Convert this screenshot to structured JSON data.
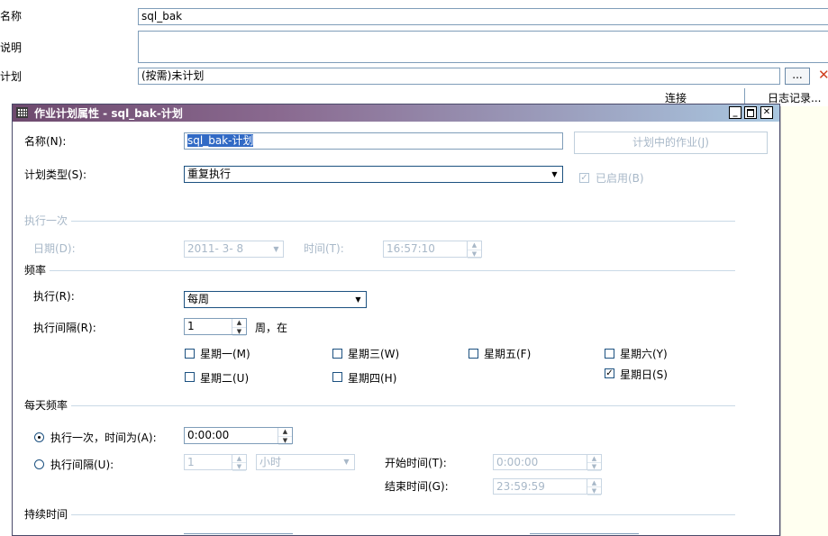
{
  "background_form": {
    "name_label": "名称",
    "name_value": "sql_bak",
    "desc_label": "说明",
    "desc_value": "",
    "schedule_label": "计划",
    "schedule_value": "(按需)未计划",
    "browse_label": "...",
    "connect_label": "连接",
    "log_label": "日志记录..."
  },
  "dialog": {
    "title": "作业计划属性 - sql_bak-计划",
    "name_label": "名称(N):",
    "name_value": "sql_bak-计划",
    "jobs_button": "计划中的作业(J)",
    "type_label": "计划类型(S):",
    "type_value": "重复执行",
    "enabled_label": "已启用(B)",
    "once_group": "执行一次",
    "once_date_label": "日期(D):",
    "once_date_value": "2011- 3- 8",
    "once_time_label": "时间(T):",
    "once_time_value": "16:57:10",
    "freq_group": "频率",
    "freq_exec_label": "执行(R):",
    "freq_exec_value": "每周",
    "freq_interval_label": "执行间隔(R):",
    "freq_interval_value": "1",
    "freq_interval_unit": "周，在",
    "weekdays": [
      {
        "label": "星期一(M)",
        "checked": false
      },
      {
        "label": "星期二(U)",
        "checked": false
      },
      {
        "label": "星期三(W)",
        "checked": false
      },
      {
        "label": "星期四(H)",
        "checked": false
      },
      {
        "label": "星期五(F)",
        "checked": false
      },
      {
        "label": "星期六(Y)",
        "checked": false
      },
      {
        "label": "星期日(S)",
        "checked": true
      }
    ],
    "daily_group": "每天频率",
    "daily_once_label": "执行一次，时间为(A):",
    "daily_once_time": "0:00:00",
    "daily_interval_label": "执行间隔(U):",
    "daily_interval_value": "1",
    "daily_interval_unit": "小时",
    "start_time_label": "开始时间(T):",
    "start_time_value": "0:00:00",
    "end_time_label": "结束时间(G):",
    "end_time_value": "23:59:59",
    "duration_group": "持续时间"
  },
  "colors": {
    "title_gradient_start": "#6e4a6e",
    "title_gradient_end": "#a9c7e0",
    "close_x": "#d04020"
  }
}
